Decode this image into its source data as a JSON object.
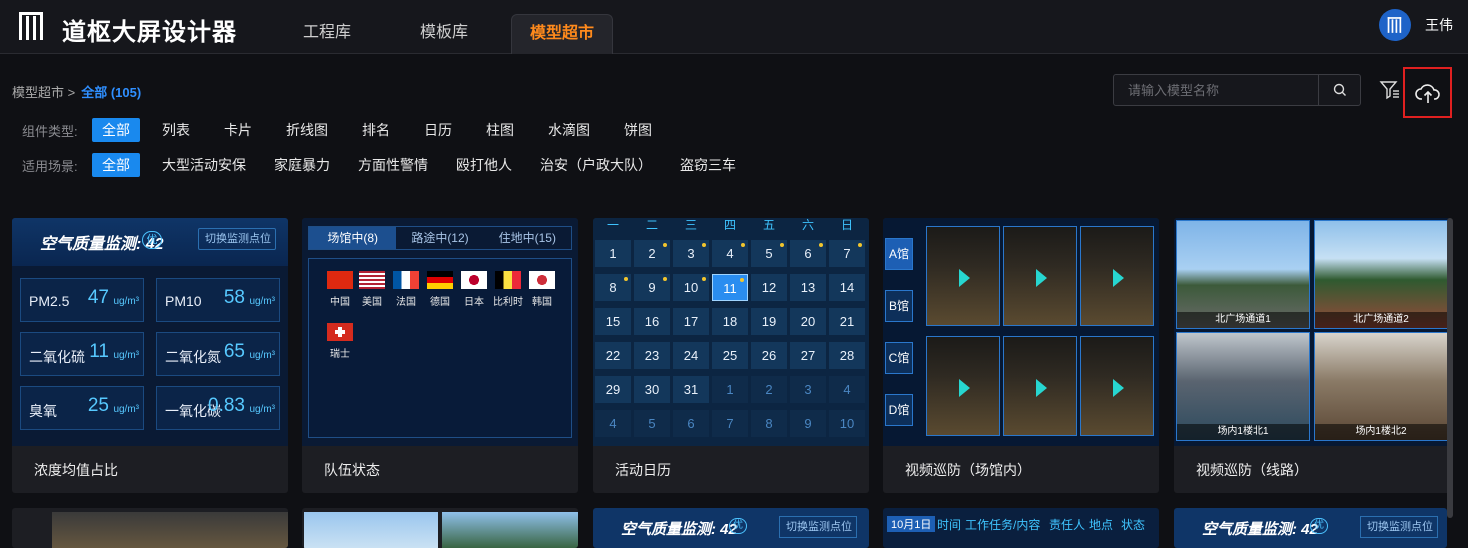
{
  "app": {
    "title": "道枢大屏设计器",
    "user": "王伟"
  },
  "nav": {
    "tabs": [
      {
        "label": "工程库"
      },
      {
        "label": "模板库"
      },
      {
        "label": "模型超市"
      }
    ]
  },
  "breadcrumb": {
    "parent": "模型超市 >",
    "current": "全部 (105)"
  },
  "search": {
    "placeholder": "请输入模型名称",
    "value": ""
  },
  "filters": {
    "type": {
      "label": "组件类型:",
      "options": [
        "全部",
        "列表",
        "卡片",
        "折线图",
        "排名",
        "日历",
        "柱图",
        "水滴图",
        "饼图"
      ],
      "selected": "全部"
    },
    "scene": {
      "label": "适用场景:",
      "options": [
        "全部",
        "大型活动安保",
        "家庭暴力",
        "方面性警情",
        "殴打他人",
        "治安（户政大队）",
        "盗窃三车"
      ],
      "selected": "全部"
    }
  },
  "cards": [
    {
      "caption": "浓度均值占比"
    },
    {
      "caption": "队伍状态"
    },
    {
      "caption": "活动日历"
    },
    {
      "caption": "视频巡防（场馆内）"
    },
    {
      "caption": "视频巡防（线路）"
    }
  ],
  "air": {
    "title": "空气质量监测: 42",
    "badge": "优",
    "selector": "切换监测点位",
    "items": [
      {
        "name": "PM2.5",
        "value": "47",
        "unit": "ug/m³"
      },
      {
        "name": "PM10",
        "value": "58",
        "unit": "ug/m³"
      },
      {
        "name": "二氧化硫",
        "value": "11",
        "unit": "ug/m³"
      },
      {
        "name": "二氧化氮",
        "value": "65",
        "unit": "ug/m³"
      },
      {
        "name": "臭氧",
        "value": "25",
        "unit": "ug/m³"
      },
      {
        "name": "一氧化碳",
        "value": "0.83",
        "unit": "ug/m³"
      }
    ]
  },
  "teams": {
    "tabs": [
      "场馆中(8)",
      "路途中(12)",
      "住地中(15)"
    ],
    "flags": [
      "中国",
      "美国",
      "法国",
      "德国",
      "日本",
      "比利时",
      "韩国",
      "瑞士"
    ]
  },
  "calendar": {
    "weekdays": [
      "一",
      "二",
      "三",
      "四",
      "五",
      "六",
      "日"
    ],
    "days": [
      [
        "1",
        "2",
        "3",
        "4",
        "5",
        "6",
        "7"
      ],
      [
        "8",
        "9",
        "10",
        "11",
        "12",
        "13",
        "14"
      ],
      [
        "15",
        "16",
        "17",
        "18",
        "19",
        "20",
        "21"
      ],
      [
        "22",
        "23",
        "24",
        "25",
        "26",
        "27",
        "28"
      ],
      [
        "29",
        "30",
        "31",
        "1",
        "2",
        "3",
        "4"
      ],
      [
        "4",
        "5",
        "6",
        "7",
        "8",
        "9",
        "10"
      ]
    ],
    "selected": "11"
  },
  "venue": {
    "buttons": [
      "A馆",
      "B馆",
      "C馆",
      "D馆"
    ]
  },
  "road": {
    "captions": [
      "北广场通道1",
      "北广场通道2",
      "场内1楼北1",
      "场内1楼北2"
    ]
  },
  "row2": {
    "air_title": "空气质量监测: 42",
    "air_badge": "优",
    "air_selector": "切换监测点位",
    "task_headers": [
      "10月1日",
      "时间",
      "工作任务/内容",
      "责任人",
      "地点",
      "状态"
    ]
  }
}
